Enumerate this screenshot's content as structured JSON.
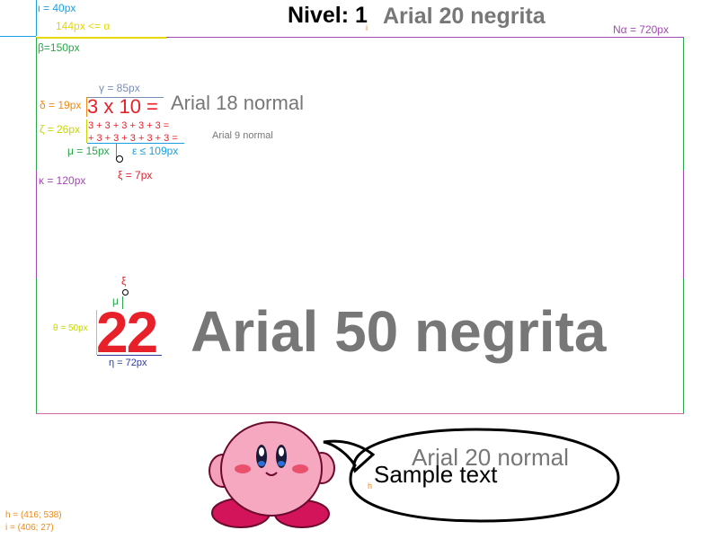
{
  "colors": {
    "cyan": "#1aa0e0",
    "yellow": "#e6d800",
    "green": "#2aa84a",
    "purple": "#a24bb0",
    "orange": "#f08a18",
    "red": "#e8202a",
    "gray": "#777777",
    "slate": "#7a8fb8",
    "navy": "#2b3aa0",
    "lime": "#c6d600",
    "frame_left": "#2aa84a",
    "frame_right": "#d46aa8"
  },
  "header": {
    "level_label": "Nivel: 1",
    "level_font_note": "Arial 20 negrita",
    "i_marker": "i"
  },
  "measures": {
    "iota": "ι = 40px",
    "alpha": "144px <= α",
    "n_alpha": "Nα = 720px",
    "beta": "β=150px",
    "gamma": "γ = 85px",
    "delta": "δ = 19px",
    "zeta": "ζ = 26px",
    "mu": "μ = 15px",
    "epsilon": "ε ≤ 109px",
    "xi": "ξ = 7px",
    "kappa": "κ = 120px",
    "xi_small": "ξ",
    "mu_small": "μ",
    "theta": "θ = 50px",
    "eta": "η = 72px"
  },
  "problem": {
    "equation": "3 x 10 =",
    "equation_font_note": "Arial 18 normal",
    "expansion_line1": "3 + 3 + 3 + 3 + 3 =",
    "expansion_line2": "+ 3 + 3 + 3 + 3 + 3 =",
    "expansion_font_note": "Arial 9 normal",
    "answer": "22",
    "answer_font_note": "Arial 50 negrita"
  },
  "mascot": {
    "speech_font_note": "Arial 20 normal",
    "speech_text": "Sample text",
    "h_marker": "h"
  },
  "coords": {
    "h": "h = (416; 538)",
    "i": "i = (406; 27)"
  }
}
